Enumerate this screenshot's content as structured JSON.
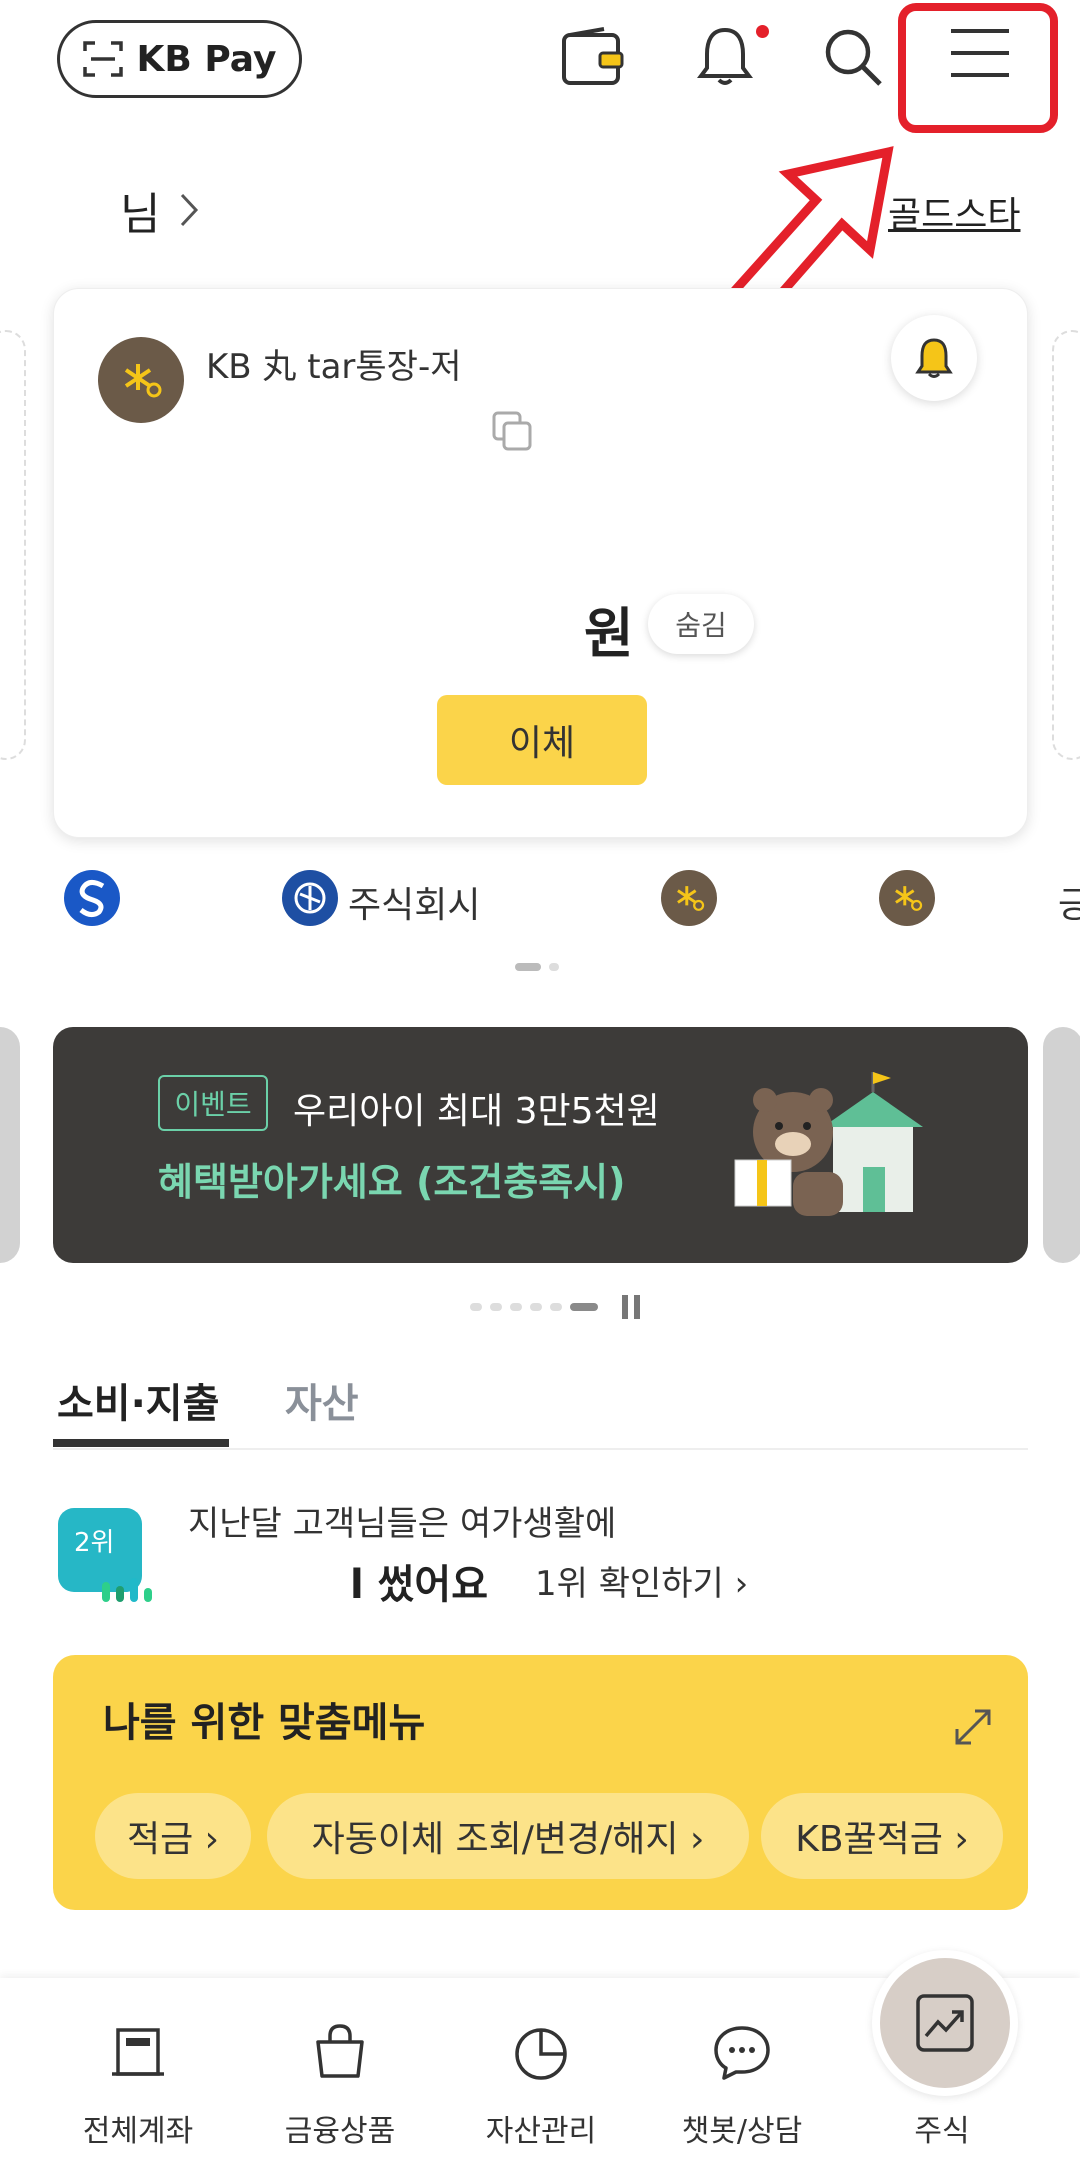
{
  "header": {
    "kbpay_label": "KB Pay",
    "icons": [
      "wallet-icon",
      "bell-icon",
      "search-icon",
      "menu-icon"
    ]
  },
  "greeting": {
    "name": "님",
    "grade_link": "골드스타"
  },
  "account_card": {
    "account_name": "KB 丸  tar통장-저",
    "currency": "원",
    "hide_label": "숨김",
    "transfer_label": "이체"
  },
  "banks": {
    "item2": "주식회시",
    "item5": "긍"
  },
  "banner": {
    "tag": "이벤트",
    "line1": "우리아이 최대 3만5천원",
    "line2": "혜택받아가세요 (조건충족시)"
  },
  "tabs": {
    "active": "소비·지출",
    "inactive": "자산"
  },
  "insight": {
    "rank": "2위",
    "line1": "지난달 고객님들은 여가생활에",
    "line2": "l 썼어요",
    "link": "1위 확인하기 ›"
  },
  "custom_menu": {
    "title": "나를 위한 맞춤메뉴",
    "chips": [
      "적금 ›",
      "자동이체 조회/변경/해지 ›",
      "KB꿀적금 ›"
    ]
  },
  "bottom_nav": {
    "items": [
      "전체계좌",
      "금융상품",
      "자산관리",
      "챗봇/상담",
      "주식"
    ]
  },
  "colors": {
    "kb_yellow": "#fbd44a",
    "kb_brown": "#6b5a48",
    "highlight_red": "#e4202a"
  }
}
